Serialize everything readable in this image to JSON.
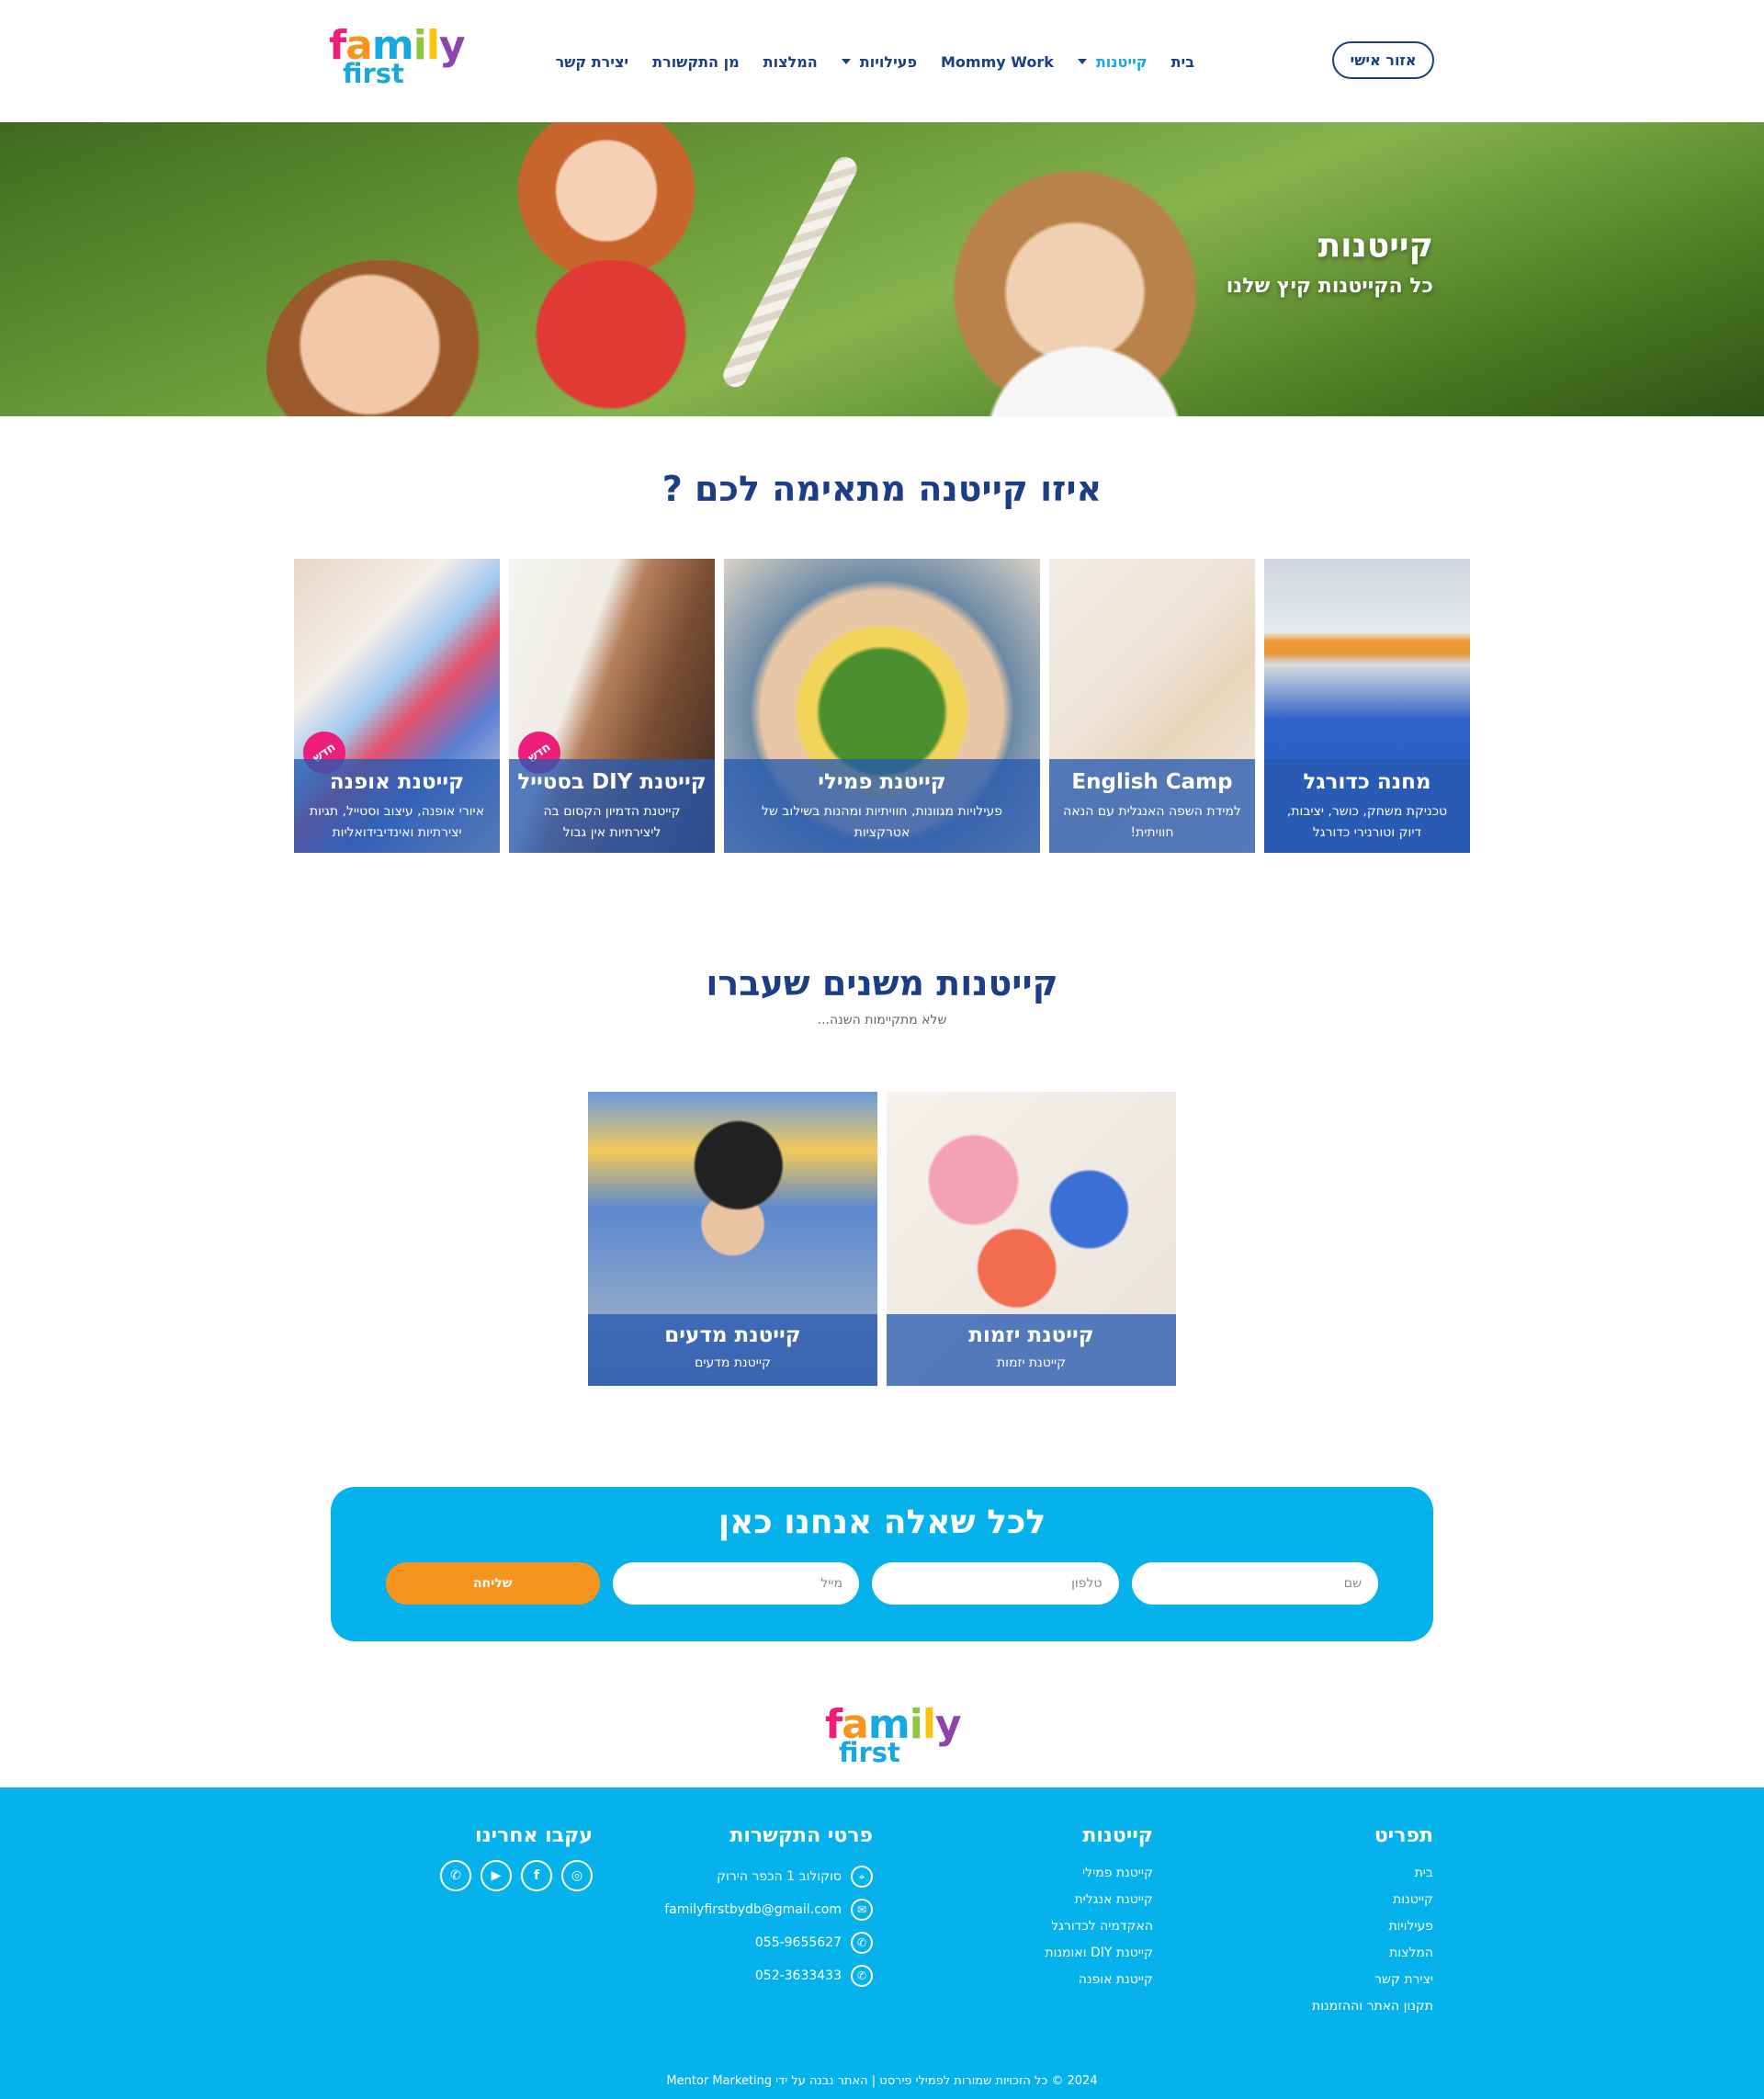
{
  "header": {
    "logo": {
      "line1": "family",
      "line2": "first"
    },
    "nav": [
      {
        "label": "בית",
        "active": false,
        "dropdown": false
      },
      {
        "label": "קייטנות",
        "active": true,
        "dropdown": true
      },
      {
        "label": "Mommy Work",
        "active": false,
        "dropdown": false
      },
      {
        "label": "פעילויות",
        "active": false,
        "dropdown": true
      },
      {
        "label": "המלצות",
        "active": false,
        "dropdown": false
      },
      {
        "label": "מן התקשורת",
        "active": false,
        "dropdown": false
      },
      {
        "label": "יצירת קשר",
        "active": false,
        "dropdown": false
      }
    ],
    "account_label": "אזור אישי"
  },
  "hero": {
    "title": "קייטנות",
    "subtitle": "כל הקייטנות קיץ שלנו"
  },
  "camps": {
    "title": "איזו קייטנה מתאימה לכם ?",
    "cards": [
      {
        "title": "מחנה כדורגל",
        "desc": "טכניקת משחק, כושר, יציבות, דיוק וטורנירי כדורגל",
        "badge": ""
      },
      {
        "title": "English Camp",
        "desc": "למידת השפה האנגלית עם הנאה חוויתית!",
        "badge": ""
      },
      {
        "title": "קייטנת פמילי",
        "desc": "פעילויות מגוונות, חוויתיות ומהנות בשילוב של אטרקציות",
        "badge": ""
      },
      {
        "title": "קייטנת DIY בסטייל",
        "desc": "קייטנת הדמיון הקסום בה ליצירתיות אין גבול",
        "badge": "חדש"
      },
      {
        "title": "קייטנת אופנה",
        "desc": "איורי אופנה, עיצוב וסטייל, תגיות יצירתיות ואינדיבידואליות",
        "badge": "חדש"
      }
    ]
  },
  "past": {
    "title": "קייטנות משנים שעברו",
    "subtitle": "שלא מתקיימות השנה...",
    "cards": [
      {
        "title": "קייטנת יזמות",
        "desc": "קייטנת יזמות"
      },
      {
        "title": "קייטנת מדעים",
        "desc": "קייטנת מדעים"
      }
    ]
  },
  "contact": {
    "title": "לכל שאלה אנחנו כאן",
    "name_placeholder": "שם",
    "phone_placeholder": "טלפון",
    "email_placeholder": "מייל",
    "submit_label": "שליחה"
  },
  "footer": {
    "logo": {
      "line1": "family",
      "line2": "first"
    },
    "menu": {
      "title": "תפריט",
      "links": [
        "בית",
        "קייטנות",
        "פעילויות",
        "המלצות",
        "יצירת קשר",
        "תקנון האתר וההזמנות"
      ]
    },
    "camps": {
      "title": "קייטנות",
      "links": [
        "קייטנת פמילי",
        "קייטנת אנגלית",
        "האקדמיה לכדורגל",
        "קייטנת DIY ואומנות",
        "קייטנת אופנה"
      ]
    },
    "contact": {
      "title": "פרטי התקשרות",
      "items": [
        {
          "icon": "location-icon",
          "text": "סוקולוב 1 הכפר הירוק"
        },
        {
          "icon": "email-icon",
          "text": "familyfirstbydb@gmail.com"
        },
        {
          "icon": "phone-icon",
          "text": "055-9655627"
        },
        {
          "icon": "phone-icon",
          "text": "052-3633433"
        }
      ]
    },
    "follow": {
      "title": "עקבו אחרינו",
      "icons": [
        "instagram-icon",
        "facebook-icon",
        "youtube-icon",
        "whatsapp-icon"
      ]
    },
    "copyright": "2024 © כל הזכויות שמורות לפמילי פירסט | האתר נבנה על ידי Mentor Marketing"
  },
  "colors": {
    "brand_navy": "#1c3e87",
    "brand_blue": "#06b2ec",
    "accent_orange": "#f7941d",
    "badge_pink": "#ed1e79"
  }
}
